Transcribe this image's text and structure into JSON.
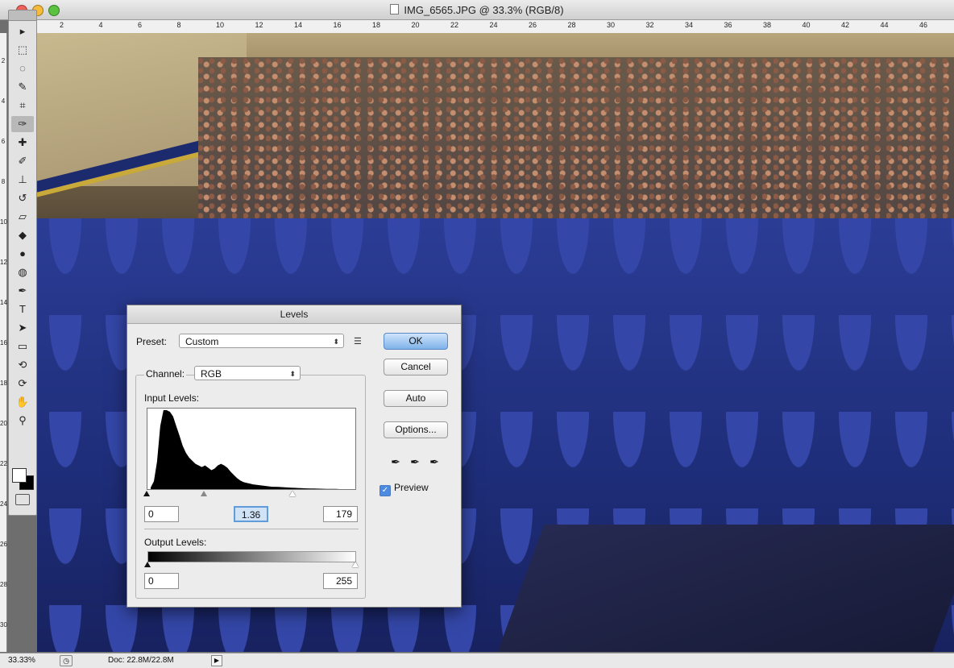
{
  "window": {
    "title": "IMG_6565.JPG @ 33.3% (RGB/8)"
  },
  "ruler": {
    "top_labels": [
      "2",
      "4",
      "6",
      "8",
      "10",
      "12",
      "14",
      "16",
      "18",
      "20",
      "22",
      "24",
      "26",
      "28",
      "30",
      "32",
      "34",
      "36",
      "38",
      "40",
      "42",
      "44",
      "46"
    ],
    "left_labels": [
      "2",
      "4",
      "6",
      "8",
      "10",
      "12",
      "14",
      "16",
      "18",
      "20",
      "22",
      "24",
      "26",
      "28",
      "30"
    ]
  },
  "toolbox": {
    "tools": [
      {
        "name": "move-tool",
        "glyph": "▸"
      },
      {
        "name": "marquee-tool",
        "glyph": "⬚"
      },
      {
        "name": "lasso-tool",
        "glyph": "◌"
      },
      {
        "name": "quick-selection-tool",
        "glyph": "✎"
      },
      {
        "name": "crop-tool",
        "glyph": "⌗"
      },
      {
        "name": "eyedropper-tool",
        "glyph": "✑"
      },
      {
        "name": "healing-brush-tool",
        "glyph": "✚"
      },
      {
        "name": "brush-tool",
        "glyph": "✐"
      },
      {
        "name": "clone-stamp-tool",
        "glyph": "⊥"
      },
      {
        "name": "history-brush-tool",
        "glyph": "↺"
      },
      {
        "name": "eraser-tool",
        "glyph": "▱"
      },
      {
        "name": "paint-bucket-tool",
        "glyph": "◆"
      },
      {
        "name": "blur-tool",
        "glyph": "●"
      },
      {
        "name": "dodge-tool",
        "glyph": "◍"
      },
      {
        "name": "pen-tool",
        "glyph": "✒"
      },
      {
        "name": "type-tool",
        "glyph": "T"
      },
      {
        "name": "path-selection-tool",
        "glyph": "➤"
      },
      {
        "name": "rectangle-tool",
        "glyph": "▭"
      },
      {
        "name": "3d-rotate-tool",
        "glyph": "⟲"
      },
      {
        "name": "3d-orbit-tool",
        "glyph": "⟳"
      },
      {
        "name": "hand-tool",
        "glyph": "✋"
      },
      {
        "name": "zoom-tool",
        "glyph": "⚲"
      }
    ]
  },
  "statusbar": {
    "zoom": "33.33%",
    "doc_size": "Doc: 22.8M/22.8M"
  },
  "levels_dialog": {
    "title": "Levels",
    "preset_label": "Preset:",
    "preset_value": "Custom",
    "channel_label": "Channel:",
    "channel_value": "RGB",
    "input_levels_label": "Input Levels:",
    "input_black": "0",
    "input_gamma": "1.36",
    "input_white": "179",
    "output_levels_label": "Output Levels:",
    "output_black": "0",
    "output_white": "255",
    "buttons": {
      "ok": "OK",
      "cancel": "Cancel",
      "auto": "Auto",
      "options": "Options..."
    },
    "preview_label": "Preview",
    "preview_checked": true,
    "histogram": [
      0.02,
      0.1,
      0.35,
      0.8,
      1.0,
      1.0,
      0.98,
      0.92,
      0.8,
      0.68,
      0.55,
      0.46,
      0.4,
      0.36,
      0.32,
      0.3,
      0.28,
      0.3,
      0.27,
      0.24,
      0.26,
      0.3,
      0.32,
      0.3,
      0.27,
      0.22,
      0.18,
      0.14,
      0.11,
      0.09,
      0.08,
      0.07,
      0.06,
      0.055,
      0.05,
      0.045,
      0.04,
      0.035,
      0.03,
      0.03,
      0.028,
      0.025,
      0.022,
      0.02,
      0.018,
      0.016,
      0.014,
      0.012,
      0.01,
      0.009,
      0.008,
      0.007,
      0.006,
      0.005,
      0.004,
      0.003,
      0.003,
      0.002,
      0.002,
      0.0,
      0.0,
      0.0,
      0.0,
      0.0
    ]
  }
}
